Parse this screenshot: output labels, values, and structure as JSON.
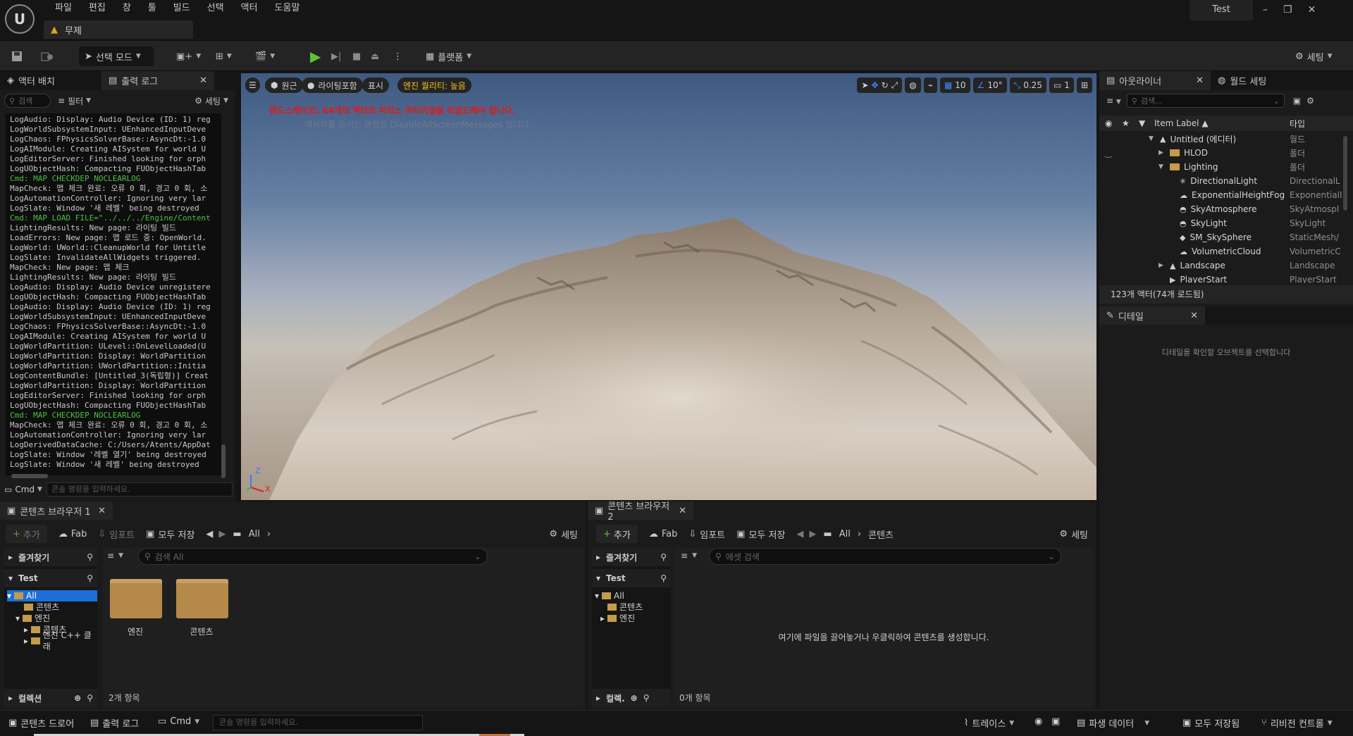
{
  "menubar": {
    "logo": "U",
    "items": [
      "파일",
      "편집",
      "창",
      "툴",
      "빌드",
      "선택",
      "액터",
      "도움말"
    ],
    "project": "Test",
    "window_controls": {
      "minimize": "–",
      "restore": "❐",
      "close": "✕"
    }
  },
  "level_tab": {
    "icon": "level-warning-icon",
    "label": "무제"
  },
  "toolbar": {
    "mode": "선택 모드",
    "platforms": "플랫폼",
    "settings": "세팅",
    "accent_play": "#5fc23a"
  },
  "left_panel": {
    "tabs": [
      "액터 배치",
      "출력 로그"
    ],
    "search_placeholder": "검색",
    "filter": "필터",
    "settings": "세팅",
    "log_lines": [
      {
        "t": "LogAudio: Display: Audio Device (ID: 1) reg",
        "c": false
      },
      {
        "t": "LogWorldSubsystemInput: UEnhancedInputDeve",
        "c": false
      },
      {
        "t": "LogChaos: FPhysicsSolverBase::AsyncDt:-1.0",
        "c": false
      },
      {
        "t": "LogAIModule: Creating AISystem for world U",
        "c": false
      },
      {
        "t": "LogEditorServer: Finished looking for orph",
        "c": false
      },
      {
        "t": "LogUObjectHash: Compacting FUObjectHashTab",
        "c": false
      },
      {
        "t": "Cmd: MAP CHECKDEP NOCLEARLOG",
        "c": true
      },
      {
        "t": "MapCheck: 맵 체크 완료: 오류 0 회, 경고 0 회, 소",
        "c": false
      },
      {
        "t": "LogAutomationController: Ignoring very lar",
        "c": false
      },
      {
        "t": "LogSlate: Window '새 레벨' being destroyed",
        "c": false
      },
      {
        "t": "Cmd: MAP LOAD FILE=\"../../../Engine/Content",
        "c": true
      },
      {
        "t": "LightingResults: New page: 라이팅 빌드",
        "c": false
      },
      {
        "t": "LoadErrors: New page: 맵 로드 중: OpenWorld.",
        "c": false
      },
      {
        "t": "LogWorld: UWorld::CleanupWorld for Untitle",
        "c": false
      },
      {
        "t": "LogSlate: InvalidateAllWidgets triggered.",
        "c": false
      },
      {
        "t": "MapCheck: New page: 맵 체크",
        "c": false
      },
      {
        "t": "LightingResults: New page: 라이팅 빌드",
        "c": false
      },
      {
        "t": "LogAudio: Display: Audio Device unregistere",
        "c": false
      },
      {
        "t": "LogUObjectHash: Compacting FUObjectHashTab",
        "c": false
      },
      {
        "t": "LogAudio: Display: Audio Device (ID: 1) reg",
        "c": false
      },
      {
        "t": "LogWorldSubsystemInput: UEnhancedInputDeve",
        "c": false
      },
      {
        "t": "LogChaos: FPhysicsSolverBase::AsyncDt:-1.0",
        "c": false
      },
      {
        "t": "LogAIModule: Creating AISystem for world U",
        "c": false
      },
      {
        "t": "LogWorldPartition: ULevel::OnLevelLoaded(U",
        "c": false
      },
      {
        "t": "LogWorldPartition: Display: WorldPartition",
        "c": false
      },
      {
        "t": "LogWorldPartition: UWorldPartition::Initia",
        "c": false
      },
      {
        "t": "LogContentBundle: [Untitled_3(독립형)] Creat",
        "c": false
      },
      {
        "t": "LogWorldPartition: Display: WorldPartition",
        "c": false
      },
      {
        "t": "LogEditorServer: Finished looking for orph",
        "c": false
      },
      {
        "t": "LogUObjectHash: Compacting FUObjectHashTab",
        "c": false
      },
      {
        "t": "Cmd: MAP CHECKDEP NOCLEARLOG",
        "c": true
      },
      {
        "t": "MapCheck: 맵 체크 완료: 오류 0 회, 경고 0 회, 소",
        "c": false
      },
      {
        "t": "LogAutomationController: Ignoring very lar",
        "c": false
      },
      {
        "t": "LogDerivedDataCache: C:/Users/Atents/AppDat",
        "c": false
      },
      {
        "t": "LogSlate: Window '레벨 열기' being destroyed",
        "c": false
      },
      {
        "t": "LogSlate: Window '새 레벨' being destroyed",
        "c": false
      }
    ],
    "cmd_label": "Cmd",
    "cmd_placeholder": "콘솔 명령을 입력하세요."
  },
  "viewport": {
    "menu": "☰",
    "perspective": "원근",
    "lighting": "라이팅포함",
    "show": "표시",
    "quality": "엔진 퀄리티: 높음",
    "warning": "랜드스케이프: 64개의 액터와 피직스 머티리얼을 리빌드해야 합니다.",
    "hint": "메시지를 숨기는 명령은 DisableAllScreenMessages 입니다.",
    "grid_snap": "10",
    "rot_snap": "10°",
    "scale_snap": "0.25",
    "cam_speed": "1",
    "axis_z": "Z",
    "axis_x": "X"
  },
  "outliner": {
    "tabs": [
      "아웃라이너",
      "월드 세팅"
    ],
    "search_placeholder": "검색...",
    "col_label": "Item Label ▲",
    "col_type": "타입",
    "rows": [
      {
        "label": "Untitled (에디터)",
        "type": "월드",
        "depth": 0,
        "kind": "world",
        "arrow": "▼"
      },
      {
        "label": "HLOD",
        "type": "폴더",
        "depth": 1,
        "kind": "folder",
        "arrow": "▶"
      },
      {
        "label": "Lighting",
        "type": "폴더",
        "depth": 1,
        "kind": "folder",
        "arrow": "▼"
      },
      {
        "label": "DirectionalLight",
        "type": "DirectionalL",
        "depth": 2,
        "kind": "light",
        "arrow": ""
      },
      {
        "label": "ExponentialHeightFog",
        "type": "ExponentialI",
        "depth": 2,
        "kind": "fog",
        "arrow": ""
      },
      {
        "label": "SkyAtmosphere",
        "type": "SkyAtmospl",
        "depth": 2,
        "kind": "sky",
        "arrow": ""
      },
      {
        "label": "SkyLight",
        "type": "SkyLight",
        "depth": 2,
        "kind": "sky",
        "arrow": ""
      },
      {
        "label": "SM_SkySphere",
        "type": "StaticMesh/",
        "depth": 2,
        "kind": "mesh",
        "arrow": ""
      },
      {
        "label": "VolumetricCloud",
        "type": "VolumetricC",
        "depth": 2,
        "kind": "cloud",
        "arrow": ""
      },
      {
        "label": "Landscape",
        "type": "Landscape",
        "depth": 1,
        "kind": "landscape",
        "arrow": "▶"
      },
      {
        "label": "PlayerStart",
        "type": "PlayerStart",
        "depth": 1,
        "kind": "start",
        "arrow": ""
      }
    ],
    "count": "123개 액터(74개 로드됨)"
  },
  "details": {
    "tab": "디테일",
    "message": "디테일을 확인할 오브젝트를 선택합니다"
  },
  "browser1": {
    "tab": "콘텐츠 브라우저 1",
    "add": "추가",
    "fab": "Fab",
    "import": "임포트",
    "save_all": "모두 저장",
    "path": [
      "All"
    ],
    "settings": "세팅",
    "favorites": "즐겨찾기",
    "project": "Test",
    "tree": [
      "All",
      "콘텐츠",
      "엔진",
      "콘텐츠",
      "엔진 C++ 클래"
    ],
    "collections": "컬렉션",
    "search_placeholder": "검색 All",
    "folders": [
      "엔진",
      "콘텐츠"
    ],
    "item_count": "2개 항목"
  },
  "browser2": {
    "tab": "콘텐츠 브라우저 2",
    "add": "추가",
    "fab": "Fab",
    "import": "임포트",
    "save_all": "모두 저장",
    "path": [
      "All",
      "콘텐츠"
    ],
    "settings": "세팅",
    "favorites": "즐겨찾기",
    "project": "Test",
    "tree": [
      "All",
      "콘텐츠",
      "엔진"
    ],
    "collections": "컬렉.",
    "search_placeholder": "에셋 검색",
    "empty_message": "여기에 파일을 끌어놓거나 우클릭하여 콘텐츠를 생성합니다.",
    "item_count": "0개 항목"
  },
  "statusbar": {
    "content_drawer": "콘텐츠 드로어",
    "output_log": "출력 로그",
    "cmd": "Cmd",
    "cmd_placeholder": "콘솔 명령을 입력하세요.",
    "trace": "트레이스",
    "derived_data": "파생 데이터",
    "save_all": "모두 저장됨",
    "revision_control": "리비전 컨트롤"
  }
}
